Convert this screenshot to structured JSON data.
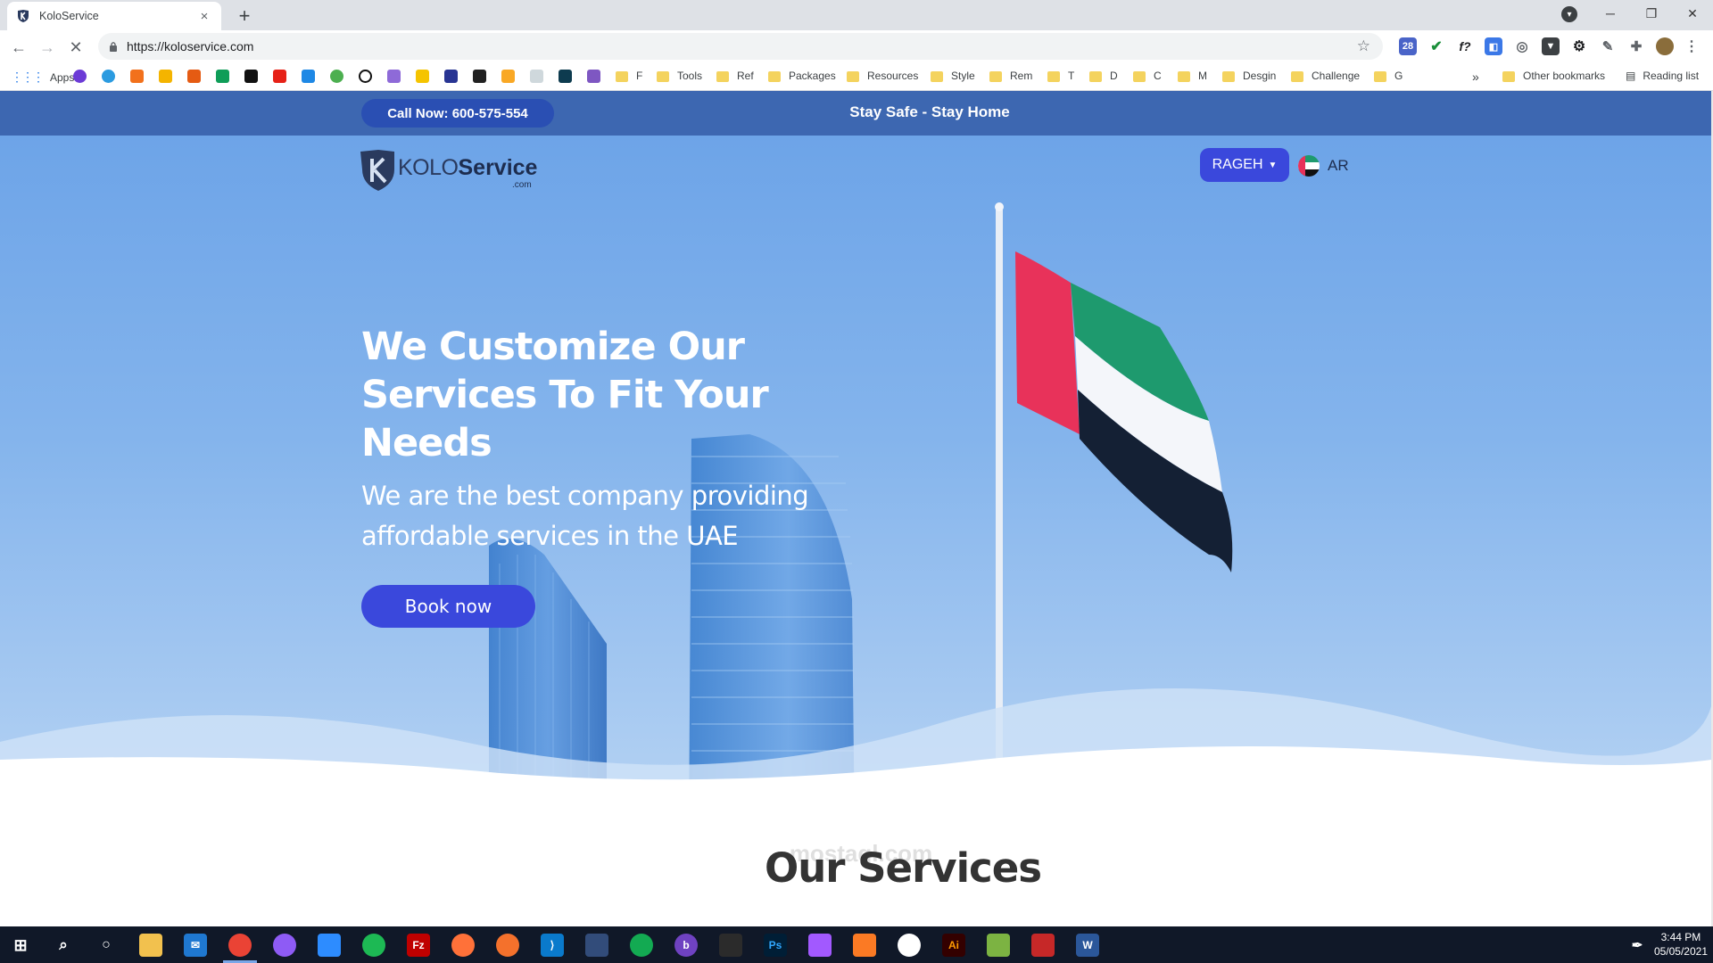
{
  "browser": {
    "tab_title": "KoloService",
    "tab_close": "×",
    "new_tab": "+",
    "url": "https://koloservice.com",
    "window_controls": {
      "minimize": "─",
      "restore": "❐",
      "close": "✕"
    },
    "bookmarks": {
      "apps": "Apps",
      "folders": [
        "F",
        "Tools",
        "Ref",
        "Packages",
        "Resources",
        "Style",
        "Rem",
        "T",
        "D",
        "C",
        "M",
        "Desgin",
        "Challenge",
        "G"
      ],
      "overflow": "»",
      "other": "Other bookmarks",
      "reading_list": "Reading list"
    }
  },
  "site": {
    "call_label": "Call Now: 600-575-554",
    "tagline": "Stay Safe - Stay Home",
    "logo": {
      "kolo": "KOLO",
      "service": "Service",
      "domain": ".com"
    },
    "user_menu": "RAGEH",
    "language": "AR",
    "hero": {
      "headline": "We Customize Our Services To Fit Your Needs",
      "subline": "We are the best company providing affordable services in the UAE",
      "cta": "Book now"
    },
    "section_title": "Our Services",
    "watermark": "mostaql.com"
  },
  "taskbar": {
    "time": "3:44 PM",
    "date": "05/05/2021"
  },
  "colors": {
    "accent": "#3a48dc",
    "topbar": "#3d67b1",
    "hero_sky": "#84b4ec"
  }
}
